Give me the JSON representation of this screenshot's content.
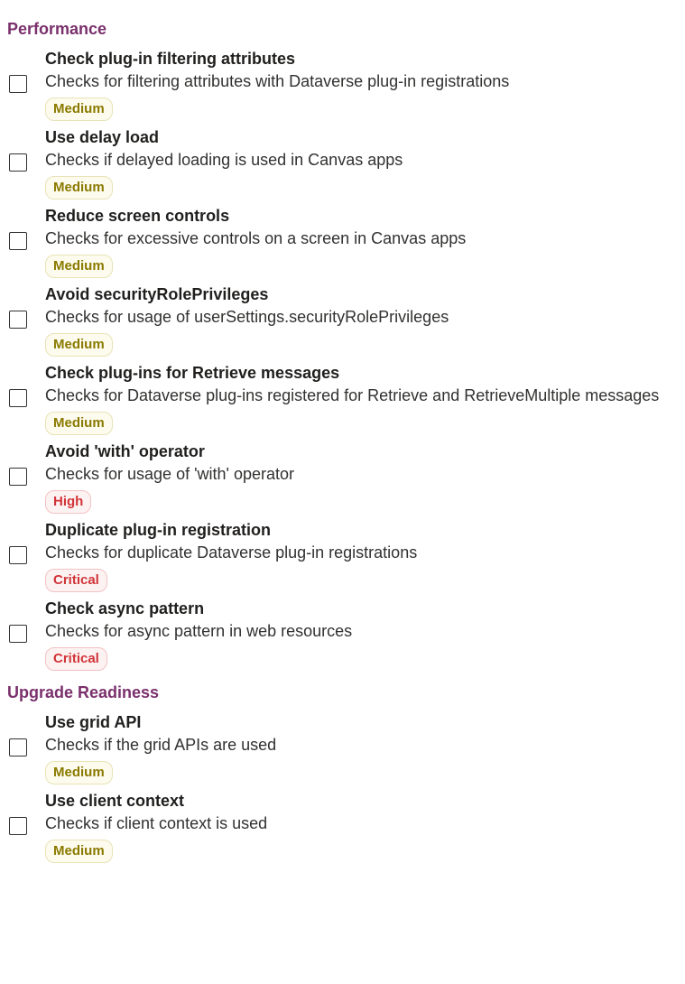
{
  "sections": [
    {
      "name": "performance",
      "title": "Performance",
      "rules": [
        {
          "id": "check-plugin-filtering",
          "title": "Check plug-in filtering attributes",
          "description": "Checks for filtering attributes with Dataverse plug-in registrations",
          "severity": "Medium",
          "severity_class": "medium"
        },
        {
          "id": "use-delay-load",
          "title": "Use delay load",
          "description": "Checks if delayed loading is used in Canvas apps",
          "severity": "Medium",
          "severity_class": "medium"
        },
        {
          "id": "reduce-screen-controls",
          "title": "Reduce screen controls",
          "description": "Checks for excessive controls on a screen in Canvas apps",
          "severity": "Medium",
          "severity_class": "medium"
        },
        {
          "id": "avoid-security-role-privileges",
          "title": "Avoid securityRolePrivileges",
          "description": "Checks for usage of userSettings.securityRolePrivileges",
          "severity": "Medium",
          "severity_class": "medium"
        },
        {
          "id": "check-plugins-retrieve",
          "title": "Check plug-ins for Retrieve messages",
          "description": "Checks for Dataverse plug-ins registered for Retrieve and RetrieveMultiple messages",
          "severity": "Medium",
          "severity_class": "medium"
        },
        {
          "id": "avoid-with-operator",
          "title": "Avoid 'with' operator",
          "description": "Checks for usage of 'with' operator",
          "severity": "High",
          "severity_class": "high"
        },
        {
          "id": "duplicate-plugin-registration",
          "title": "Duplicate plug-in registration",
          "description": "Checks for duplicate Dataverse plug-in registrations",
          "severity": "Critical",
          "severity_class": "critical"
        },
        {
          "id": "check-async-pattern",
          "title": "Check async pattern",
          "description": "Checks for async pattern in web resources",
          "severity": "Critical",
          "severity_class": "critical"
        }
      ]
    },
    {
      "name": "upgrade-readiness",
      "title": "Upgrade Readiness",
      "rules": [
        {
          "id": "use-grid-api",
          "title": "Use grid API",
          "description": "Checks if the grid APIs are used",
          "severity": "Medium",
          "severity_class": "medium"
        },
        {
          "id": "use-client-context",
          "title": "Use client context",
          "description": "Checks if client context is used",
          "severity": "Medium",
          "severity_class": "medium"
        }
      ]
    }
  ]
}
